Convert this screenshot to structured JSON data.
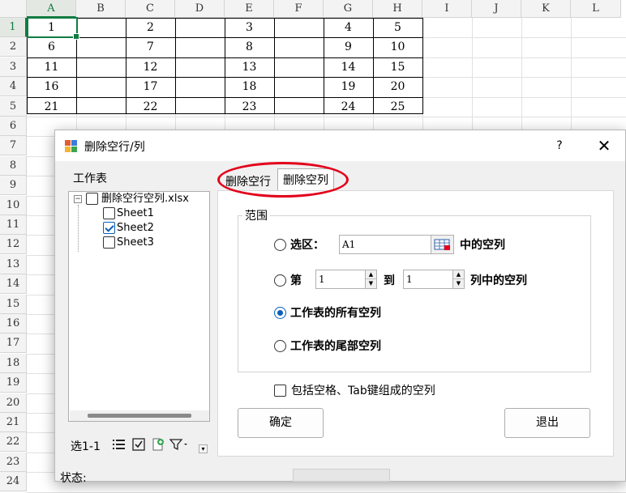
{
  "sheet": {
    "columns": [
      "A",
      "B",
      "C",
      "D",
      "E",
      "F",
      "G",
      "H",
      "I",
      "J",
      "K",
      "L"
    ],
    "rows": [
      "1",
      "2",
      "3",
      "4",
      "5",
      "6",
      "7",
      "8",
      "9",
      "10",
      "11",
      "12",
      "13",
      "14",
      "15",
      "16",
      "17",
      "18",
      "19",
      "20",
      "21",
      "22",
      "23",
      "24"
    ],
    "cells": [
      [
        "1",
        "",
        "2",
        "",
        "3",
        "",
        "4",
        "5"
      ],
      [
        "6",
        "",
        "7",
        "",
        "8",
        "",
        "9",
        "10"
      ],
      [
        "11",
        "",
        "12",
        "",
        "13",
        "",
        "14",
        "15"
      ],
      [
        "16",
        "",
        "17",
        "",
        "18",
        "",
        "19",
        "20"
      ],
      [
        "21",
        "",
        "22",
        "",
        "23",
        "",
        "24",
        "25"
      ]
    ]
  },
  "dialog": {
    "title": "删除空行/列",
    "help": "?",
    "close": "✕",
    "worksheet_label": "工作表",
    "tree": {
      "file": "删除空行空列.xlsx",
      "sheets": [
        {
          "name": "Sheet1",
          "checked": false
        },
        {
          "name": "Sheet2",
          "checked": true
        },
        {
          "name": "Sheet3",
          "checked": false
        }
      ]
    },
    "selection_count": "选1-1",
    "tabs": [
      "删除空行",
      "删除空列"
    ],
    "active_tab": "删除空列",
    "range_legend": "范围",
    "options": {
      "selection_label": "选区：",
      "selection_value": "A1",
      "selection_suffix": "中的空列",
      "from_label": "第",
      "from_value": "1",
      "to_label": "到",
      "to_value": "1",
      "to_suffix": "列中的空列",
      "all_label": "工作表的所有空列",
      "tail_label": "工作表的尾部空列",
      "selected": "all"
    },
    "include_blank_label": "包括空格、Tab键组成的空列",
    "ok_label": "确定",
    "exit_label": "退出",
    "status_label": "状态:",
    "accent_color": "#0b5fb8",
    "highlight_color": "#e3001b"
  }
}
